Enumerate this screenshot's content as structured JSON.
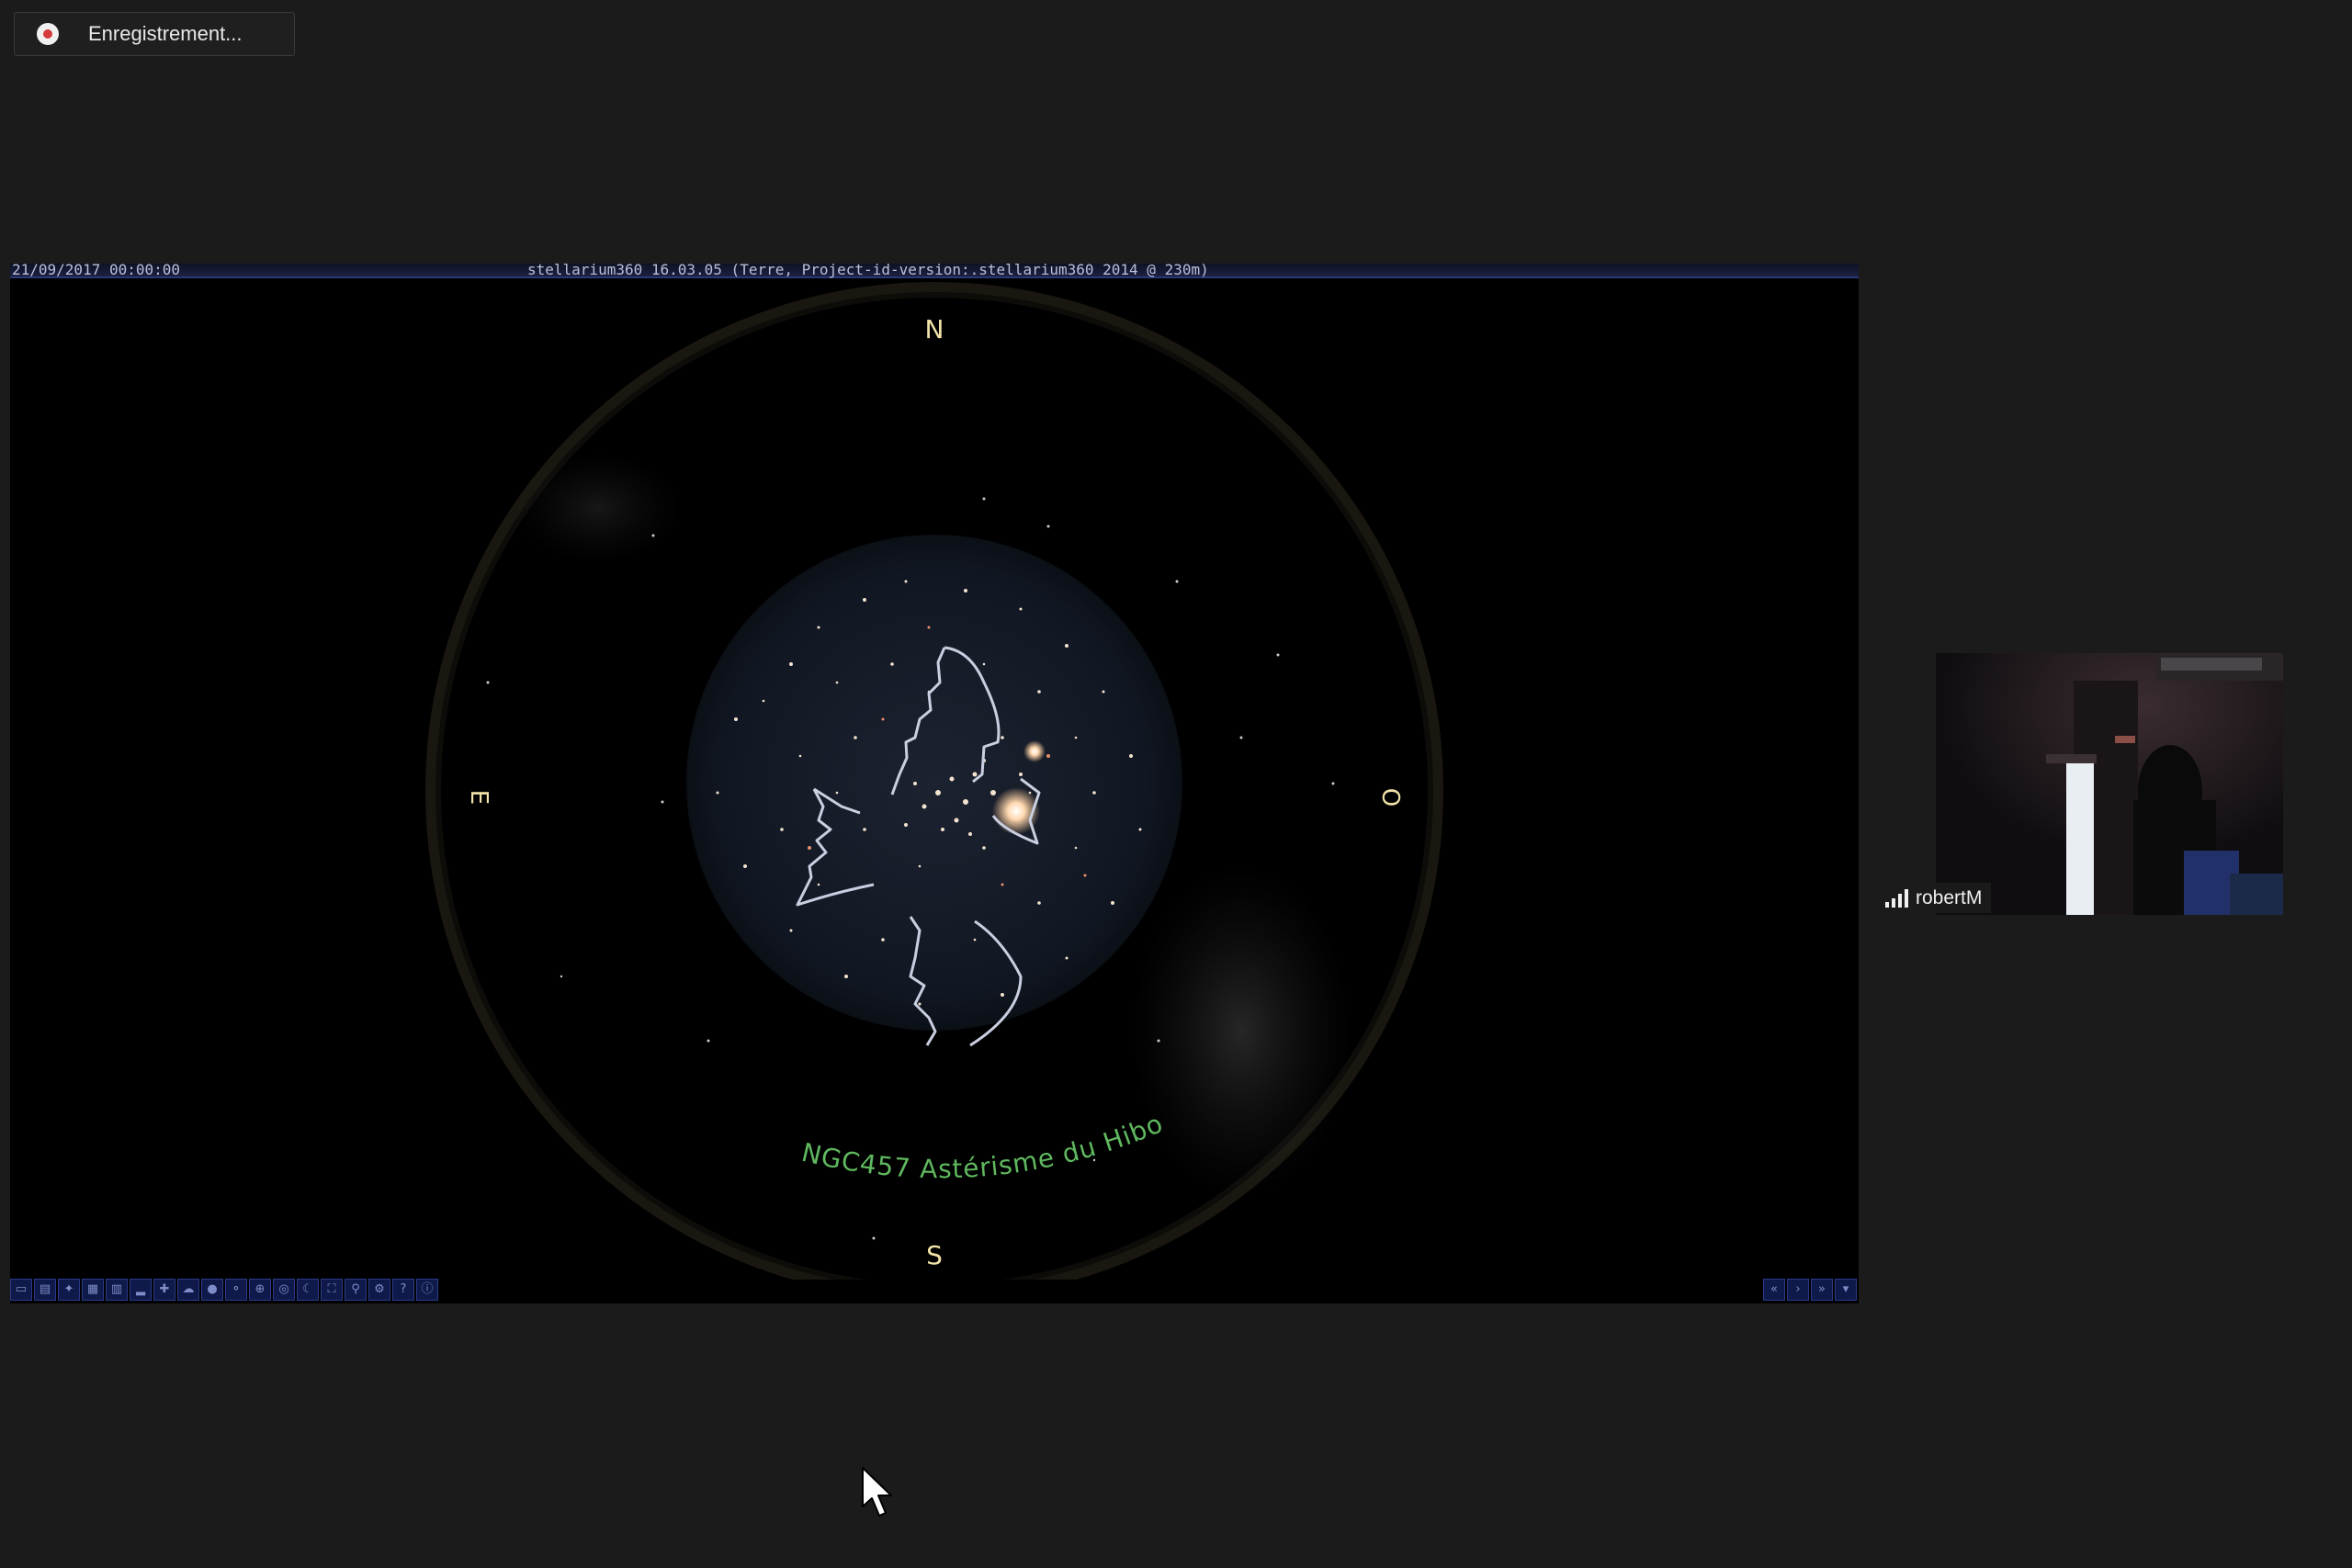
{
  "recording": {
    "label": "Enregistrement...",
    "icon": "recording-icon",
    "accent_color": "#d63b3b"
  },
  "stellarium": {
    "datetime": "21/09/2017 00:00:00",
    "title": "stellarium360 16.03.05 (Terre, Project-id-version:.stellarium360 2014 @ 230m)",
    "cardinals": {
      "north": "N",
      "south": "S",
      "east": "E",
      "west": "O"
    },
    "object_label": "NGC457 Astérisme du Hibou",
    "label_color": "#5fb85f",
    "cardinal_color": "#f2e3a8",
    "toolbar_left_icons": [
      "constellation-lines-icon",
      "constellation-labels-icon",
      "constellation-art-icon",
      "equatorial-grid-icon",
      "azimuthal-grid-icon",
      "ground-icon",
      "cardinal-points-icon",
      "atmosphere-icon",
      "nebula-icon",
      "planet-labels-icon",
      "equatorial-mount-icon",
      "center-object-icon",
      "night-mode-icon",
      "fullscreen-icon",
      "search-icon",
      "settings-icon",
      "help-icon",
      "info-icon"
    ],
    "toolbar_right_icons": [
      "rewind-icon",
      "play-icon",
      "fast-forward-icon",
      "menu-icon"
    ]
  },
  "participant": {
    "name": "robertM",
    "icon": "signal-strength-icon"
  }
}
